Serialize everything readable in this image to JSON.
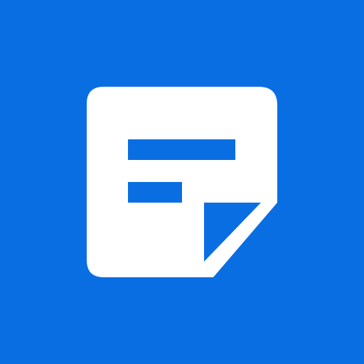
{
  "icon": {
    "name": "sticky-note-icon",
    "background_color": "#0a6ee3",
    "note_color": "#ffffff",
    "line_color": "#0a6ee3",
    "fold_color": "#0a6ee3"
  }
}
